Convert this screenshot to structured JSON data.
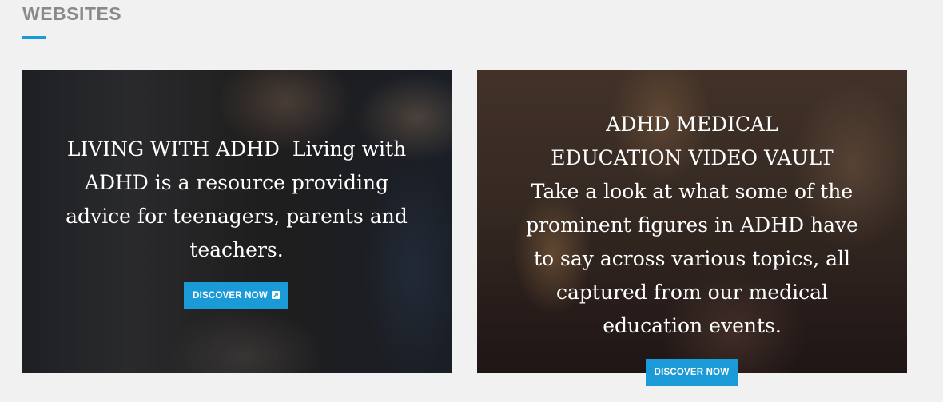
{
  "section": {
    "title": "WEBSITES",
    "accent_color": "#1a9ad6"
  },
  "cards": [
    {
      "heading": "LIVING WITH ADHD",
      "body": "Living with ADHD is a resource providing advice for teenagers, parents and teachers.",
      "button_label": "DISCOVER NOW",
      "button_icon": "external-link-icon"
    },
    {
      "heading": "ADHD MEDICAL EDUCATION VIDEO VAULT",
      "body": "Take a look at what some of the prominent figures in ADHD have to say across various topics, all captured from our medical education events.",
      "button_label": "DISCOVER NOW"
    }
  ]
}
